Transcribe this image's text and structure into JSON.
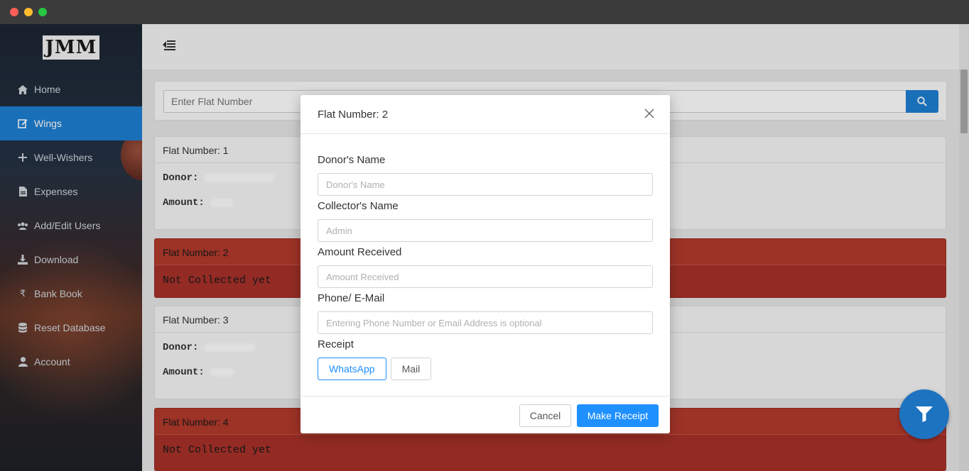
{
  "logo": {
    "text": "JMM"
  },
  "sidebar": {
    "items": [
      {
        "label": "Home",
        "icon": "home-icon",
        "active": false
      },
      {
        "label": "Wings",
        "icon": "edit-icon",
        "active": true
      },
      {
        "label": "Well-Wishers",
        "icon": "plus-icon",
        "active": false
      },
      {
        "label": "Expenses",
        "icon": "file-icon",
        "active": false
      },
      {
        "label": "Add/Edit Users",
        "icon": "users-icon",
        "active": false
      },
      {
        "label": "Download",
        "icon": "download-icon",
        "active": false
      },
      {
        "label": "Bank Book",
        "icon": "rupee-icon",
        "active": false
      },
      {
        "label": "Reset Database",
        "icon": "database-icon",
        "active": false
      },
      {
        "label": "Account",
        "icon": "user-icon",
        "active": false
      }
    ]
  },
  "search": {
    "placeholder": "Enter Flat Number"
  },
  "cards": [
    {
      "title": "Flat Number: 1",
      "status": "collected",
      "donor_label": "Donor:",
      "amount_label": "Amount:"
    },
    {
      "title": "Flat Number: 2",
      "status": "pending",
      "message": "Not Collected yet"
    },
    {
      "title": "Flat Number: 3",
      "status": "collected",
      "donor_label": "Donor:",
      "amount_label": "Amount:"
    },
    {
      "title": "Flat Number: 4",
      "status": "pending",
      "message": "Not Collected yet"
    }
  ],
  "modal": {
    "title": "Flat Number: 2",
    "fields": [
      {
        "label": "Donor's Name",
        "placeholder": "Donor's Name",
        "value": ""
      },
      {
        "label": "Collector's Name",
        "placeholder": "Admin",
        "value": ""
      },
      {
        "label": "Amount Received",
        "placeholder": "Amount Received",
        "value": ""
      },
      {
        "label": "Phone/ E-Mail",
        "placeholder": "Entering Phone Number or Email Address is optional",
        "value": ""
      }
    ],
    "receipt_label": "Receipt",
    "receipt_options": [
      "WhatsApp",
      "Mail"
    ],
    "cancel_label": "Cancel",
    "submit_label": "Make Receipt"
  },
  "colors": {
    "accent": "#1e90ff",
    "sidebar_active": "#1e7fd3",
    "pending_card": "#a93226",
    "fab": "#1e73c0"
  }
}
